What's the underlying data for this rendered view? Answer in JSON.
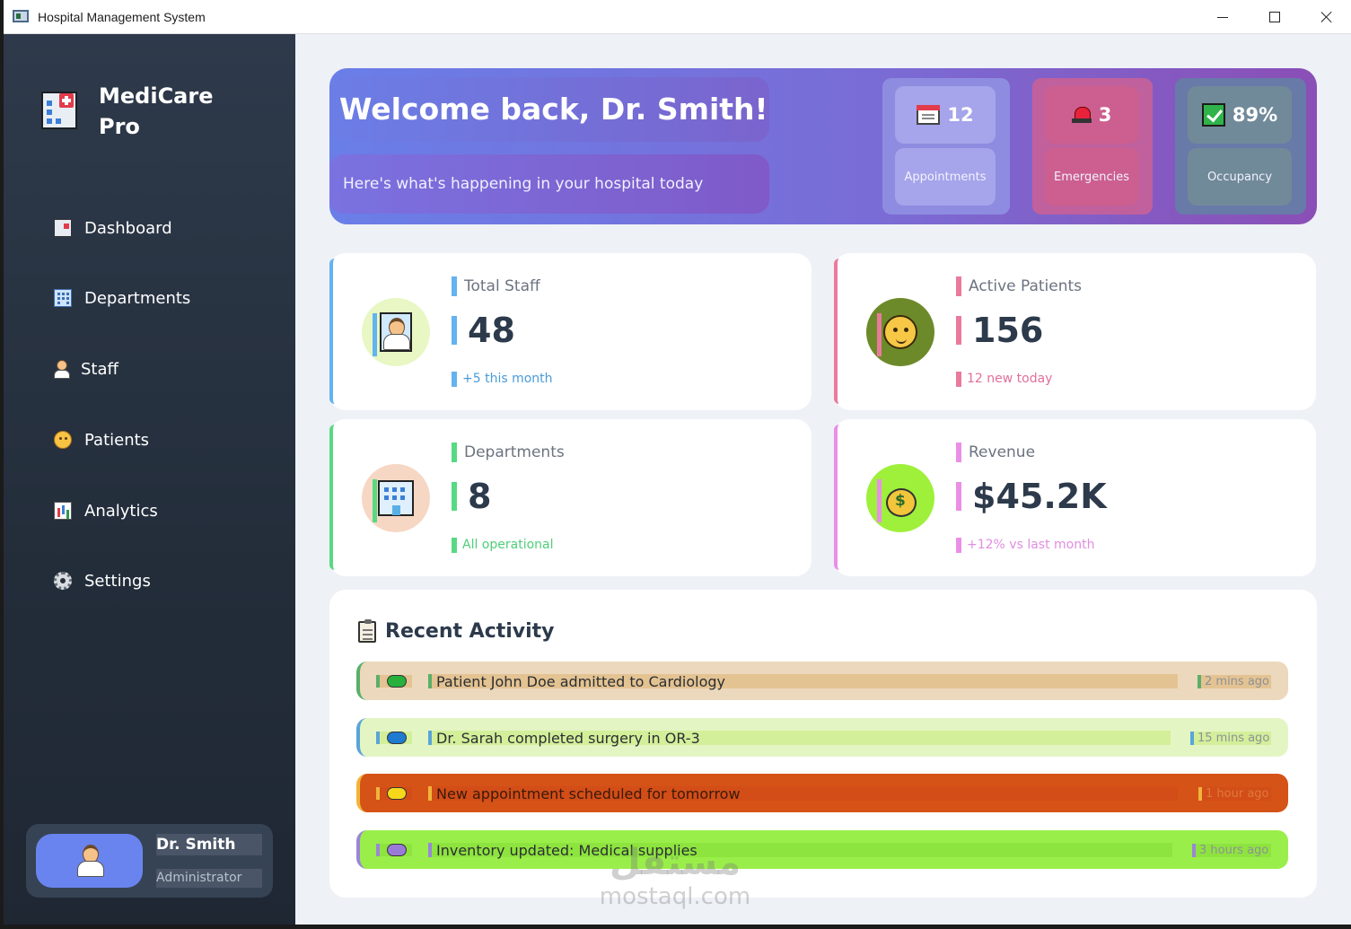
{
  "window": {
    "title": "Hospital Management System"
  },
  "sidebar": {
    "brand_line1": "MediCare",
    "brand_line2": "Pro",
    "items": [
      {
        "label": "Dashboard",
        "icon": "dashboard-icon"
      },
      {
        "label": "Departments",
        "icon": "building-icon"
      },
      {
        "label": "Staff",
        "icon": "staff-icon"
      },
      {
        "label": "Patients",
        "icon": "patient-face-icon"
      },
      {
        "label": "Analytics",
        "icon": "chart-icon"
      },
      {
        "label": "Settings",
        "icon": "gear-icon"
      }
    ],
    "user": {
      "name": "Dr. Smith",
      "role": "Administrator"
    }
  },
  "hero": {
    "title": "Welcome back, Dr. Smith!",
    "subtitle": "Here's what's happening in your hospital today",
    "tiles": [
      {
        "value": "12",
        "label": "Appointments",
        "icon": "calendar-icon"
      },
      {
        "value": "3",
        "label": "Emergencies",
        "icon": "siren-icon"
      },
      {
        "value": "89%",
        "label": "Occupancy",
        "icon": "checkmark-icon"
      }
    ]
  },
  "stats": {
    "staff": {
      "label": "Total Staff",
      "value": "48",
      "note": "+5 this month"
    },
    "patients": {
      "label": "Active Patients",
      "value": "156",
      "note": "12 new today"
    },
    "departments": {
      "label": "Departments",
      "value": "8",
      "note": "All operational"
    },
    "revenue": {
      "label": "Revenue",
      "value": "$45.2K",
      "note": "+12% vs last month"
    }
  },
  "activity": {
    "title": "Recent Activity",
    "items": [
      {
        "text": "Patient John Doe admitted to Cardiology",
        "time": "2 mins ago"
      },
      {
        "text": "Dr. Sarah completed surgery in OR-3",
        "time": "15 mins ago"
      },
      {
        "text": "New appointment scheduled for tomorrow",
        "time": "1 hour ago"
      },
      {
        "text": "Inventory updated: Medical supplies",
        "time": "3 hours ago"
      }
    ]
  },
  "watermark": {
    "line1": "مستقل",
    "line2": "mostaql.com"
  },
  "colors": {
    "sidebar": "#2a3544",
    "hero_start": "#6a7ee8",
    "hero_end": "#8a4fb6",
    "staff_accent": "#62b3f0",
    "patients_accent": "#ea7a9c",
    "departments_accent": "#58d983",
    "revenue_accent": "#ea8ee8"
  }
}
